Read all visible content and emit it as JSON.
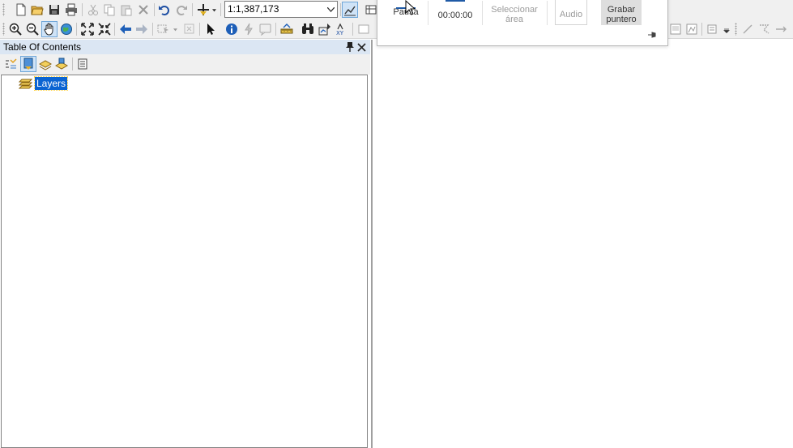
{
  "toolbar": {
    "scale_value": "1:1,387,173",
    "standard_icons": [
      "new-document-icon",
      "open-folder-icon",
      "save-icon",
      "print-icon",
      "cut-icon",
      "copy-icon",
      "paste-icon",
      "delete-icon",
      "undo-icon",
      "redo-icon",
      "add-data-icon",
      "add-data-dropdown-icon",
      "scale-dropdown-icon",
      "editor-toolbar-icon"
    ],
    "tools_icons": [
      "zoom-in-icon",
      "zoom-out-icon",
      "pan-icon",
      "full-extent-icon",
      "fixed-zoom-in-icon",
      "fixed-zoom-out-icon",
      "go-back-icon",
      "go-forward-icon",
      "select-features-icon",
      "clear-selection-icon",
      "select-elements-icon",
      "identify-icon",
      "hyperlink-icon",
      "html-popup-icon",
      "measure-icon",
      "find-icon",
      "find-route-icon",
      "go-to-xy-icon"
    ]
  },
  "toc": {
    "title": "Table Of Contents",
    "toolbar_icons": [
      "list-by-drawing-order-icon",
      "list-by-source-icon",
      "list-by-visibility-icon",
      "list-by-selection-icon",
      "options-icon"
    ],
    "root_label": "Layers",
    "selected_highlight": "#0a64d2"
  },
  "recorder": {
    "pause_label": "Pausa",
    "timer": "00:00:00",
    "select_area_line1": "Seleccionar",
    "select_area_line2": "área",
    "audio_label": "Audio",
    "pointer_line1": "Grabar",
    "pointer_line2": "puntero"
  },
  "colors": {
    "toc_header_bg": "#dbe6f3",
    "toolbar_bg": "#f0f0f0",
    "accent_blue": "#1f5aa6"
  }
}
